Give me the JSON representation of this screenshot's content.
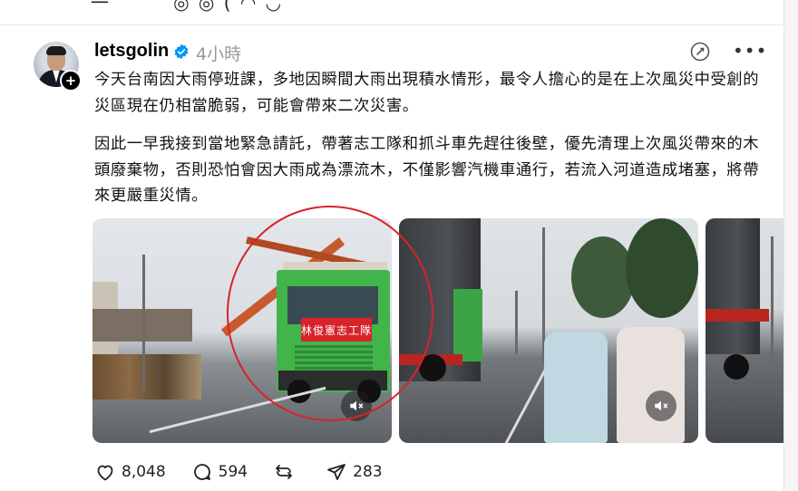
{
  "post": {
    "username": "letsgolin",
    "time": "4小時",
    "paragraphs": [
      "今天台南因大雨停班課，多地因瞬間大雨出現積水情形，最令人擔心的是在上次風災中受創的災區現在仍相當脆弱，可能會帶來二次災害。",
      "因此一早我接到當地緊急請託，帶著志工隊和抓斗車先趕往後壁，優先清理上次風災帶來的木頭廢棄物，否則恐怕會因大雨成為漂流木，不僅影響汽機車通行，若流入河道造成堵塞，將帶來更嚴重災情。"
    ],
    "truck_banner": "林俊憲志工隊",
    "vest_text": "林俊憲"
  },
  "actions": {
    "likes": "8,048",
    "comments": "594",
    "shares": "283"
  },
  "icons": [
    "heart-icon",
    "comment-icon",
    "repost-icon",
    "share-icon",
    "verified-icon",
    "quote-icon",
    "more-icon",
    "mute-icon"
  ],
  "colors": {
    "accent": "#0095f6",
    "annotation_ring": "#d8232a",
    "muted_text": "#999999"
  }
}
